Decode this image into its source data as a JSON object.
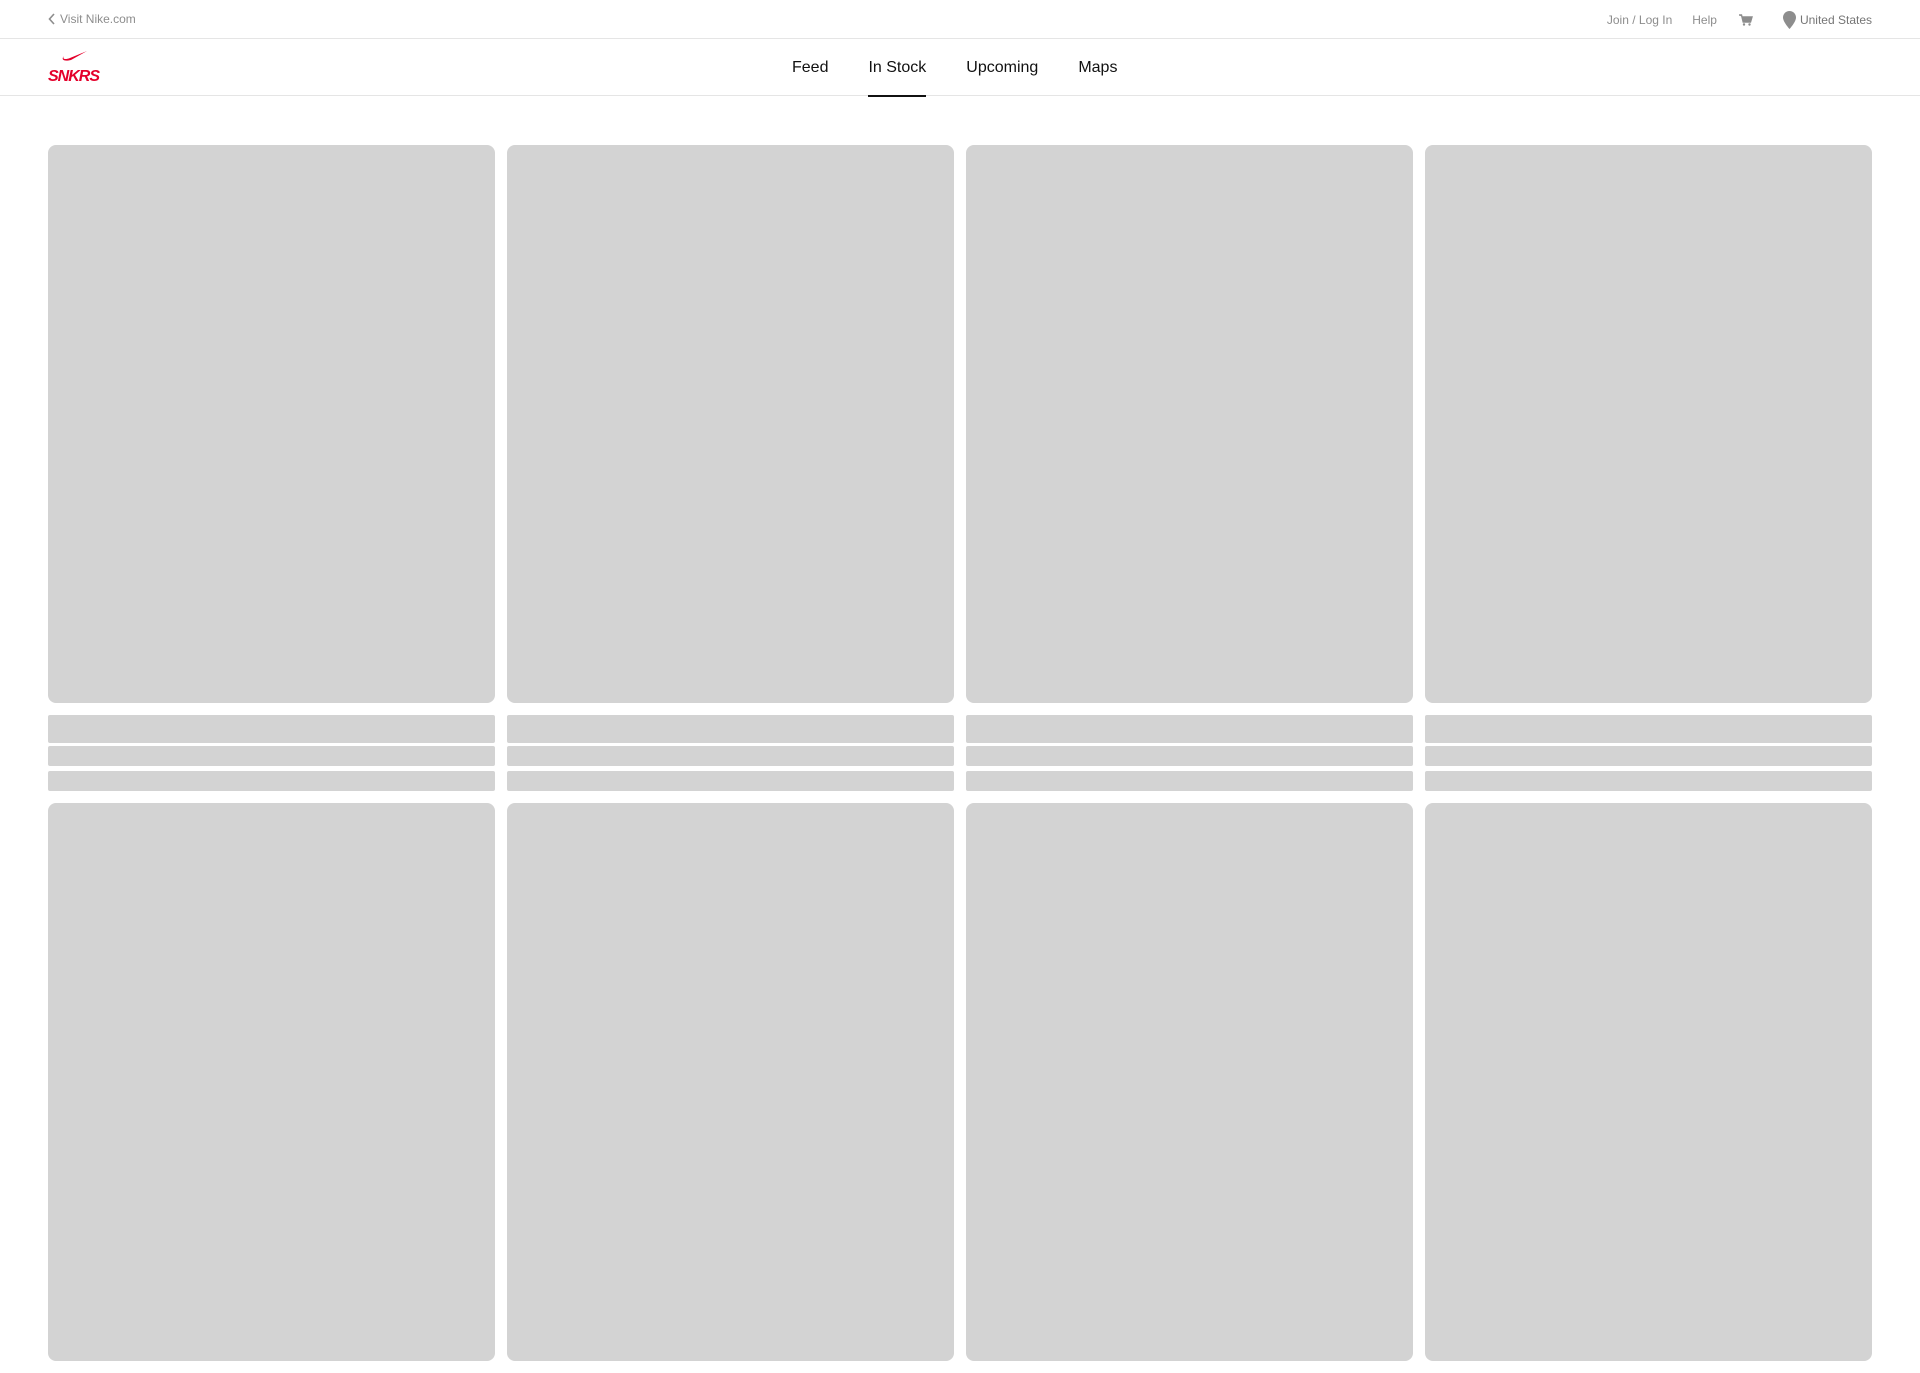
{
  "utility_bar": {
    "visit_link": "Visit Nike.com",
    "join_login": "Join / Log In",
    "help": "Help",
    "cart_icon": "cart-icon",
    "location_icon": "location-pin-icon",
    "location": "United States"
  },
  "brand": {
    "logo_text": "SNKRS",
    "accent_color": "#e4002b"
  },
  "nav": {
    "tabs": [
      {
        "label": "Feed",
        "active": false
      },
      {
        "label": "In Stock",
        "active": true
      },
      {
        "label": "Upcoming",
        "active": false
      },
      {
        "label": "Maps",
        "active": false
      }
    ]
  },
  "placeholder_color": "#d3d3d3"
}
